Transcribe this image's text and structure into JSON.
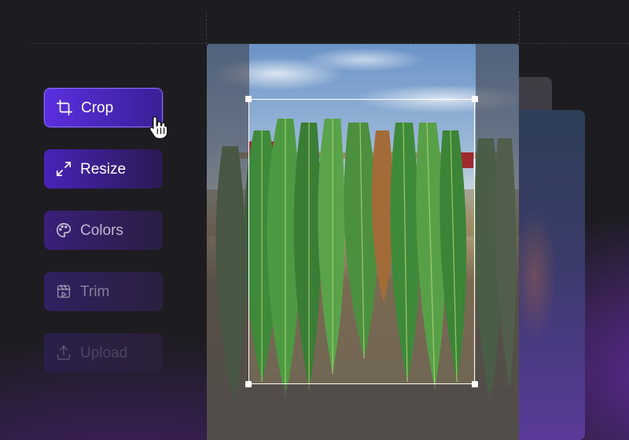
{
  "tools": {
    "crop_label": "Crop",
    "resize_label": "Resize",
    "colors_label": "Colors",
    "trim_label": "Trim",
    "upload_label": "Upload"
  },
  "icons": {
    "crop": "crop-icon",
    "resize": "expand-arrows-icon",
    "colors": "palette-icon",
    "trim": "clapperboard-icon",
    "upload": "upload-icon",
    "cursor": "hand-pointer-icon"
  },
  "colors": {
    "active_tool": "#5b2fe0",
    "accent_border": "#8b6bff",
    "background": "#1d1c20",
    "crop_frame": "#ffffff"
  }
}
